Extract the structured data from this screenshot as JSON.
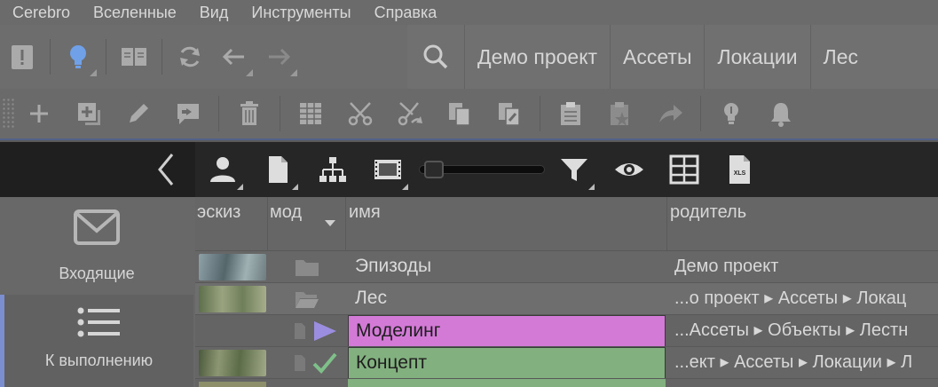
{
  "menu": [
    "Cerebro",
    "Вселенные",
    "Вид",
    "Инструменты",
    "Справка"
  ],
  "breadcrumbs": [
    "Демо проект",
    "Ассеты",
    "Локации",
    "Лес"
  ],
  "sidebar": {
    "inbox_label": "Входящие",
    "todo_label": "К выполнению"
  },
  "table": {
    "headers": {
      "sketch": "эскиз",
      "mod": "мод",
      "name": "имя",
      "parent": "родитель"
    },
    "rows": [
      {
        "name": "Эпизоды",
        "parent": "Демо проект",
        "status": "folder"
      },
      {
        "name": "Лес",
        "parent": "...о проект ▸ Ассеты ▸ Локац",
        "status": "folder-open"
      },
      {
        "name": "Моделинг",
        "parent": "...Ассеты ▸ Объекты ▸ Лестн",
        "status": "play"
      },
      {
        "name": "Концепт",
        "parent": "...ект ▸ Ассеты ▸ Локации ▸ Л",
        "status": "check"
      }
    ]
  },
  "colors": {
    "modeling_bg": "#d27ad6",
    "concept_bg": "#83b07f",
    "accent": "#7b8fd0",
    "idea_icon": "#6fa0e8"
  }
}
